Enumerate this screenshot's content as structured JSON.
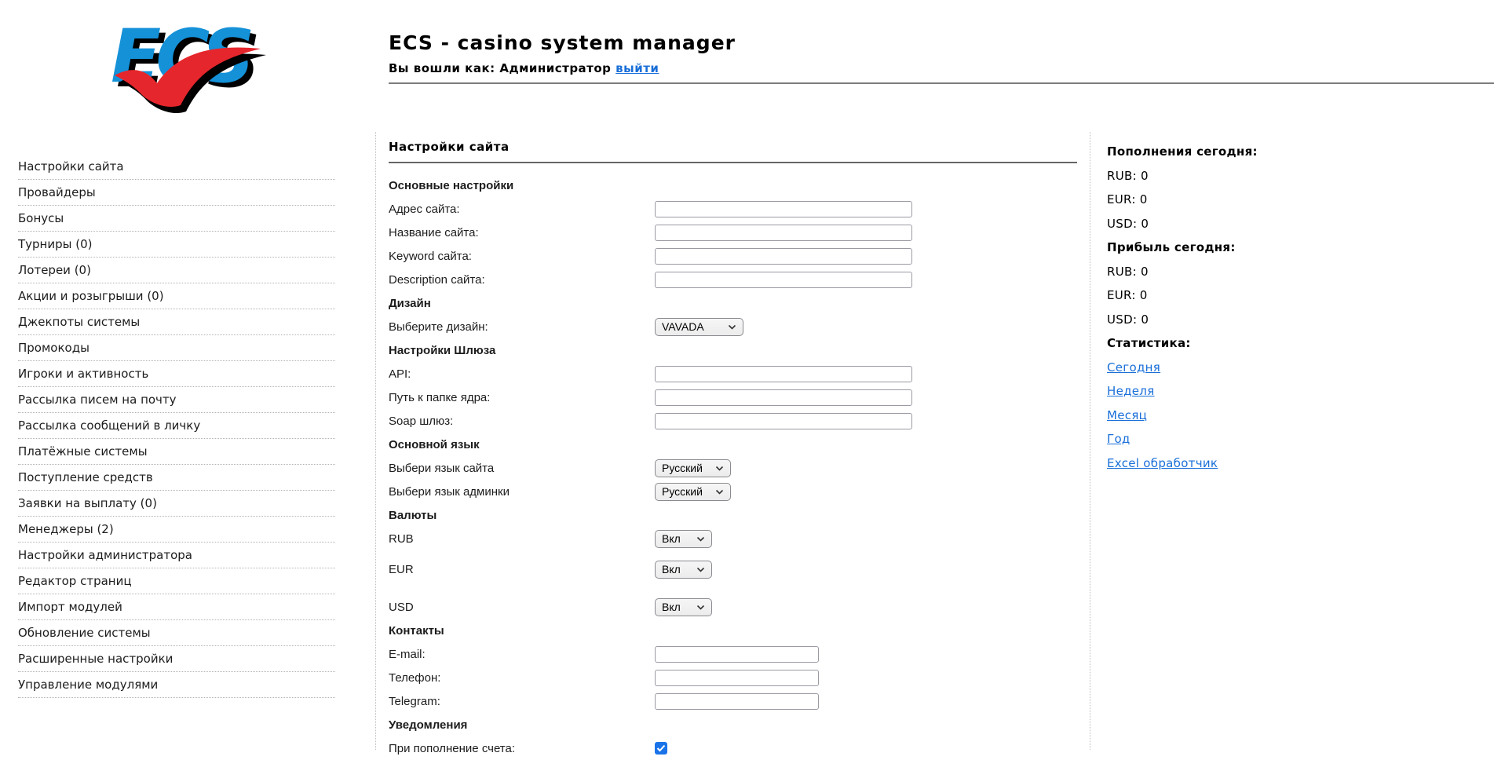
{
  "header": {
    "logo_text": "ECS",
    "title": "ECS - casino system manager",
    "login_prefix": "Вы вошли как: Администратор",
    "logout_label": "выйти"
  },
  "colors": {
    "link_blue": "#1a6fd8",
    "logo_blue": "#1591d8",
    "logo_red": "#e5262c",
    "checkbox_blue": "#1a73e8"
  },
  "sidebar": {
    "items": [
      "Настройки сайта",
      "Провайдеры",
      "Бонусы",
      "Турниры (0)",
      "Лотереи (0)",
      "Акции и розыгрыши (0)",
      "Джекпоты системы",
      "Промокоды",
      "Игроки и активность",
      "Рассылка писем на почту",
      "Рассылка сообщений в личку",
      "Платёжные системы",
      "Поступление средств",
      "Заявки на выплату (0)",
      "Менеджеры (2)",
      "Настройки администратора",
      "Редактор страниц",
      "Импорт модулей",
      "Обновление системы",
      "Расширенные настройки",
      "Управление модулями"
    ]
  },
  "form": {
    "heading": "Настройки сайта",
    "rows": [
      {
        "type": "section",
        "label": "Основные настройки"
      },
      {
        "type": "text",
        "label": "Адрес сайта:",
        "value": ""
      },
      {
        "type": "text",
        "label": "Название сайта:",
        "value": ""
      },
      {
        "type": "text",
        "label": "Keyword сайта:",
        "value": ""
      },
      {
        "type": "text",
        "label": "Description сайта:",
        "value": ""
      },
      {
        "type": "section",
        "label": "Дизайн"
      },
      {
        "type": "select",
        "label": "Выберите дизайн:",
        "value": "VAVADA"
      },
      {
        "type": "section",
        "label": "Настройки Шлюза"
      },
      {
        "type": "text",
        "label": "API:",
        "value": ""
      },
      {
        "type": "text",
        "label": "Путь к папке ядра:",
        "value": ""
      },
      {
        "type": "text",
        "label": "Soap шлюз:",
        "value": ""
      },
      {
        "type": "section",
        "label": "Основной язык"
      },
      {
        "type": "select",
        "label": "Выбери язык сайта",
        "value": "Русский"
      },
      {
        "type": "select",
        "label": "Выбери язык админки",
        "value": "Русский"
      },
      {
        "type": "section",
        "label": "Валюты"
      },
      {
        "type": "select",
        "label": "RUB",
        "value": "Вкл"
      },
      {
        "type": "select",
        "label": "EUR",
        "value": "Вкл"
      },
      {
        "type": "select",
        "label": "USD",
        "value": "Вкл"
      },
      {
        "type": "section",
        "label": "Контакты"
      },
      {
        "type": "text",
        "label": "E-mail:",
        "value": ""
      },
      {
        "type": "text",
        "label": "Телефон:",
        "value": ""
      },
      {
        "type": "text",
        "label": "Telegram:",
        "value": ""
      },
      {
        "type": "section",
        "label": "Уведомления"
      },
      {
        "type": "checkbox",
        "label": "При пополнение счета:",
        "checked": true
      }
    ]
  },
  "right": {
    "sections": [
      {
        "title": "Пополнения сегодня:",
        "rows": [
          "RUB: 0",
          "EUR: 0",
          "USD: 0"
        ]
      },
      {
        "title": "Прибыль сегодня:",
        "rows": [
          "RUB: 0",
          "EUR: 0",
          "USD: 0"
        ]
      },
      {
        "title": "Статистика:",
        "links": [
          "Сегодня",
          "Неделя",
          "Месяц",
          "Год",
          "Excel обработчик"
        ]
      }
    ]
  }
}
